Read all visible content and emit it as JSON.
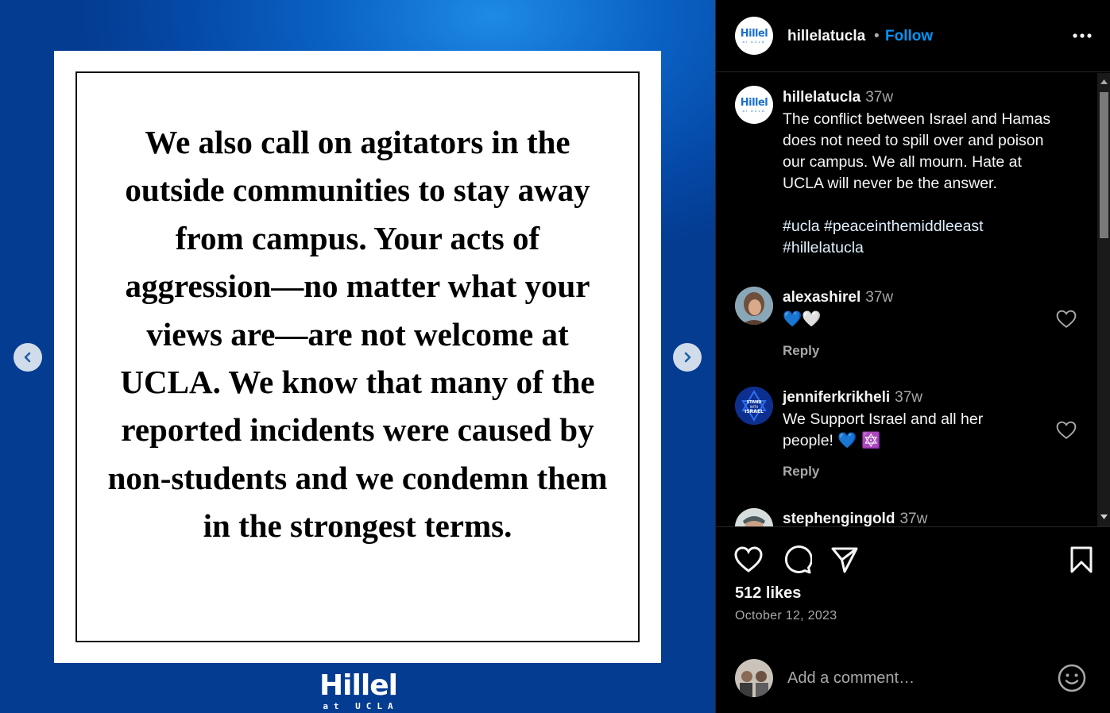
{
  "media": {
    "slide_lines": [
      "We also call on agitators in the",
      "outside communities to stay away",
      "from campus. Your acts of",
      "aggression—no matter what your",
      "views are—are not welcome at",
      "UCLA. We know that many of the",
      "reported incidents were caused by",
      "non-students and we condemn them",
      "in the strongest terms."
    ],
    "logo_main": "Hillel",
    "logo_sub": "at UCLA",
    "prev_icon": "chevron-left-icon",
    "next_icon": "chevron-right-icon"
  },
  "header": {
    "avatar_logo_main": "Hillel",
    "avatar_logo_sub": "at UCLA",
    "username": "hillelatucla",
    "separator": "•",
    "follow_label": "Follow",
    "more_icon": "more-horizontal-icon"
  },
  "caption": {
    "username": "hillelatucla",
    "time": "37w",
    "lines": [
      "The conflict between Israel and Hamas",
      "does not need to spill over and poison",
      "our campus. We all mourn. Hate at",
      "UCLA will never be the answer."
    ],
    "hashtags_line1": "#ucla #peaceinthemiddleeast",
    "hashtags_line2": "#hillelatucla"
  },
  "comments": [
    {
      "username": "alexashirel",
      "time": "37w",
      "text_lines": [
        "💙🤍"
      ],
      "reply_label": "Reply"
    },
    {
      "username": "jenniferkrikheli",
      "time": "37w",
      "avatar_text_1": "STAND",
      "avatar_text_2": "WITH",
      "avatar_text_3": "ISRAEL",
      "text_lines": [
        "We Support Israel and all her",
        "people! 💙 🔯"
      ],
      "reply_label": "Reply"
    },
    {
      "username": "stephengingold",
      "time": "37w"
    }
  ],
  "actions": {
    "like_icon": "heart-icon",
    "comment_icon": "comment-icon",
    "share_icon": "send-icon",
    "save_icon": "bookmark-icon",
    "likes_text": "512 likes",
    "date_text": "October 12, 2023"
  },
  "add_comment": {
    "placeholder": "Add a comment…",
    "emoji_icon": "emoji-smile-icon"
  },
  "colors": {
    "follow_blue": "#0095f6",
    "brand_blue": "#0a62c4",
    "muted_gray": "#a8a8a8"
  }
}
